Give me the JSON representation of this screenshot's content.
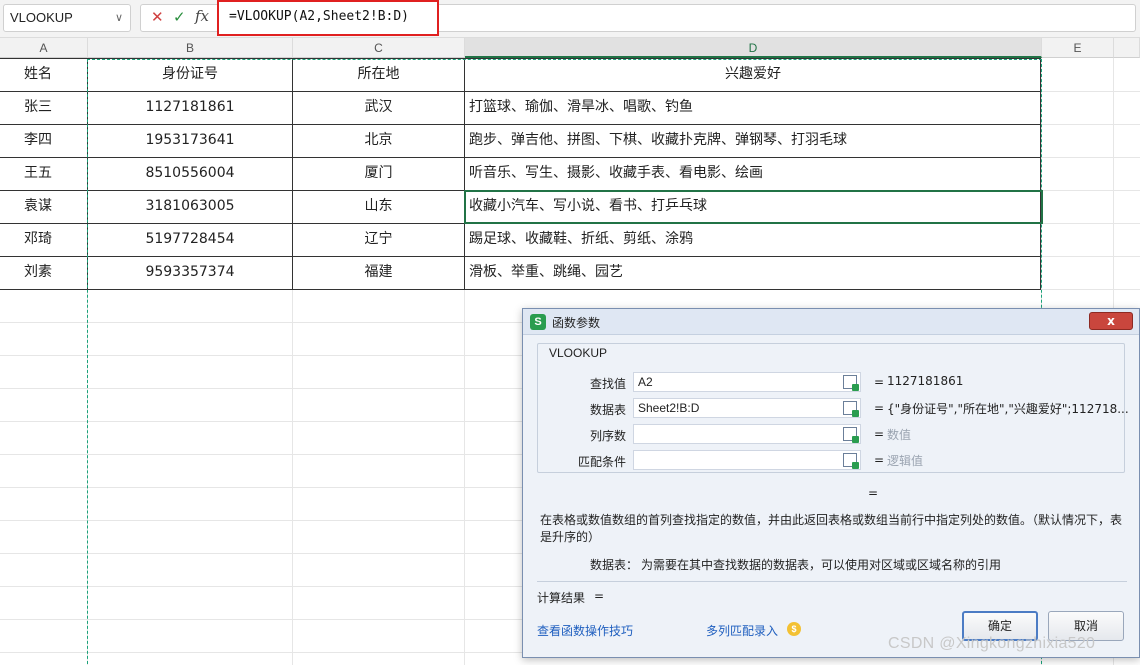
{
  "formula_bar": {
    "name_box": "VLOOKUP",
    "cancel_icon": "close-icon",
    "enter_icon": "check-icon",
    "fx_label": "fx",
    "formula": "=VLOOKUP(A2,Sheet2!B:D)"
  },
  "sheet": {
    "column_headers": [
      "A",
      "B",
      "C",
      "D",
      "E"
    ],
    "header_row": [
      "姓名",
      "身份证号",
      "所在地",
      "兴趣爱好"
    ],
    "rows": [
      [
        "张三",
        "1127181861",
        "武汉",
        "打篮球、瑜伽、滑旱冰、唱歌、钓鱼"
      ],
      [
        "李四",
        "1953173641",
        "北京",
        "跑步、弹吉他、拼图、下棋、收藏扑克牌、弹钢琴、打羽毛球"
      ],
      [
        "王五",
        "8510556004",
        "厦门",
        "听音乐、写生、摄影、收藏手表、看电影、绘画"
      ],
      [
        "袁谋",
        "3181063005",
        "山东",
        "收藏小汽车、写小说、看书、打乒乓球"
      ],
      [
        "邓琦",
        "5197728454",
        "辽宁",
        "踢足球、收藏鞋、折纸、剪纸、涂鸦"
      ],
      [
        "刘素",
        "9593357374",
        "福建",
        "滑板、举重、跳绳、园艺"
      ]
    ],
    "selected_column": "D",
    "accent_color": "#217346",
    "copy_border_color": "#1aa37a"
  },
  "dialog": {
    "logo": "S",
    "title": "函数参数",
    "close_label": "x",
    "function_name": "VLOOKUP",
    "args": [
      {
        "label": "查找值",
        "value": "A2",
        "result": "1127181861",
        "hint": false
      },
      {
        "label": "数据表",
        "value": "Sheet2!B:D",
        "result": "{\"身份证号\",\"所在地\",\"兴趣爱好\";112718...",
        "hint": false
      },
      {
        "label": "列序数",
        "value": "",
        "result": "数值",
        "hint": true
      },
      {
        "label": "匹配条件",
        "value": "",
        "result": "逻辑值",
        "hint": true
      }
    ],
    "equals": "=",
    "description": "在表格或数值数组的首列查找指定的数值，并由此返回表格或数组当前行中指定列处的数值。（默认情况下，表是升序的）",
    "arg_desc_label": "数据表：",
    "arg_desc": "为需要在其中查找数据的数据表，可以使用对区域或区域名称的引用",
    "result_label": "计算结果",
    "result_eq": "=",
    "link_tips": "查看函数操作技巧",
    "link_multi": "多列匹配录入",
    "coin_icon": "coin-icon",
    "ok_label": "确定",
    "cancel_label": "取消"
  },
  "watermark": "CSDN @Xingkongzhixia520"
}
